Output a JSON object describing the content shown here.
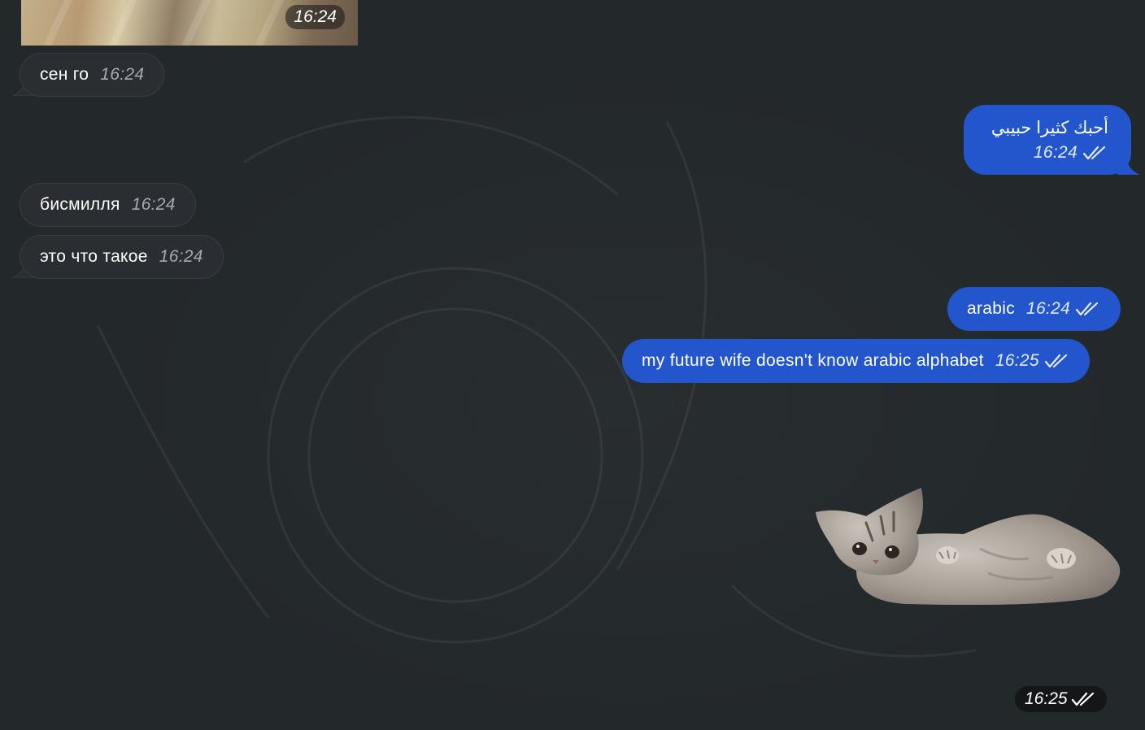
{
  "photo_message": {
    "time": "16:24"
  },
  "messages": [
    {
      "direction": "incoming",
      "text": "сен го",
      "time": "16:24"
    },
    {
      "direction": "outgoing",
      "text": "أحبك كثيرا حبيبي",
      "time": "16:24",
      "status": "read"
    },
    {
      "direction": "incoming",
      "text": "бисмилля",
      "time": "16:24"
    },
    {
      "direction": "incoming",
      "text": "это что такое",
      "time": "16:24"
    },
    {
      "direction": "outgoing",
      "text": "arabic",
      "time": "16:24",
      "status": "read"
    },
    {
      "direction": "outgoing",
      "text": "my future wife doesn't know arabic alphabet",
      "time": "16:25",
      "status": "read"
    }
  ],
  "sticker_message": {
    "time": "16:25",
    "status": "read",
    "icon": "kitten-sticker"
  },
  "colors": {
    "background": "#23282b",
    "incoming_bubble": "#2a2d31",
    "outgoing_bubble": "#2356cc"
  }
}
